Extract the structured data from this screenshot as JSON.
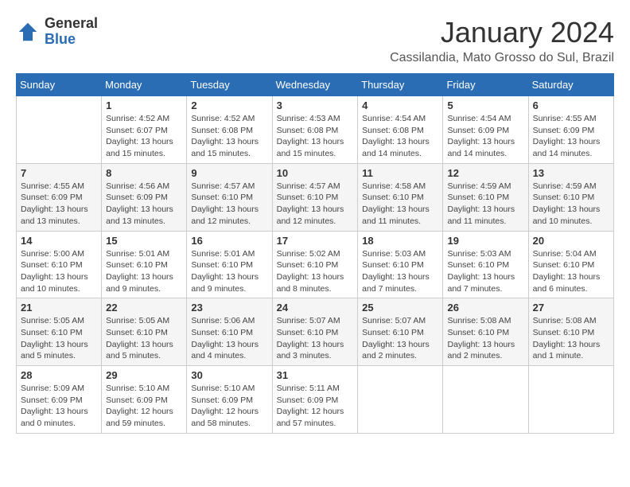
{
  "logo": {
    "general": "General",
    "blue": "Blue"
  },
  "title": "January 2024",
  "location": "Cassilandia, Mato Grosso do Sul, Brazil",
  "days_header": [
    "Sunday",
    "Monday",
    "Tuesday",
    "Wednesday",
    "Thursday",
    "Friday",
    "Saturday"
  ],
  "weeks": [
    [
      {
        "day": "",
        "info": ""
      },
      {
        "day": "1",
        "info": "Sunrise: 4:52 AM\nSunset: 6:07 PM\nDaylight: 13 hours\nand 15 minutes."
      },
      {
        "day": "2",
        "info": "Sunrise: 4:52 AM\nSunset: 6:08 PM\nDaylight: 13 hours\nand 15 minutes."
      },
      {
        "day": "3",
        "info": "Sunrise: 4:53 AM\nSunset: 6:08 PM\nDaylight: 13 hours\nand 15 minutes."
      },
      {
        "day": "4",
        "info": "Sunrise: 4:54 AM\nSunset: 6:08 PM\nDaylight: 13 hours\nand 14 minutes."
      },
      {
        "day": "5",
        "info": "Sunrise: 4:54 AM\nSunset: 6:09 PM\nDaylight: 13 hours\nand 14 minutes."
      },
      {
        "day": "6",
        "info": "Sunrise: 4:55 AM\nSunset: 6:09 PM\nDaylight: 13 hours\nand 14 minutes."
      }
    ],
    [
      {
        "day": "7",
        "info": "Sunrise: 4:55 AM\nSunset: 6:09 PM\nDaylight: 13 hours\nand 13 minutes."
      },
      {
        "day": "8",
        "info": "Sunrise: 4:56 AM\nSunset: 6:09 PM\nDaylight: 13 hours\nand 13 minutes."
      },
      {
        "day": "9",
        "info": "Sunrise: 4:57 AM\nSunset: 6:10 PM\nDaylight: 13 hours\nand 12 minutes."
      },
      {
        "day": "10",
        "info": "Sunrise: 4:57 AM\nSunset: 6:10 PM\nDaylight: 13 hours\nand 12 minutes."
      },
      {
        "day": "11",
        "info": "Sunrise: 4:58 AM\nSunset: 6:10 PM\nDaylight: 13 hours\nand 11 minutes."
      },
      {
        "day": "12",
        "info": "Sunrise: 4:59 AM\nSunset: 6:10 PM\nDaylight: 13 hours\nand 11 minutes."
      },
      {
        "day": "13",
        "info": "Sunrise: 4:59 AM\nSunset: 6:10 PM\nDaylight: 13 hours\nand 10 minutes."
      }
    ],
    [
      {
        "day": "14",
        "info": "Sunrise: 5:00 AM\nSunset: 6:10 PM\nDaylight: 13 hours\nand 10 minutes."
      },
      {
        "day": "15",
        "info": "Sunrise: 5:01 AM\nSunset: 6:10 PM\nDaylight: 13 hours\nand 9 minutes."
      },
      {
        "day": "16",
        "info": "Sunrise: 5:01 AM\nSunset: 6:10 PM\nDaylight: 13 hours\nand 9 minutes."
      },
      {
        "day": "17",
        "info": "Sunrise: 5:02 AM\nSunset: 6:10 PM\nDaylight: 13 hours\nand 8 minutes."
      },
      {
        "day": "18",
        "info": "Sunrise: 5:03 AM\nSunset: 6:10 PM\nDaylight: 13 hours\nand 7 minutes."
      },
      {
        "day": "19",
        "info": "Sunrise: 5:03 AM\nSunset: 6:10 PM\nDaylight: 13 hours\nand 7 minutes."
      },
      {
        "day": "20",
        "info": "Sunrise: 5:04 AM\nSunset: 6:10 PM\nDaylight: 13 hours\nand 6 minutes."
      }
    ],
    [
      {
        "day": "21",
        "info": "Sunrise: 5:05 AM\nSunset: 6:10 PM\nDaylight: 13 hours\nand 5 minutes."
      },
      {
        "day": "22",
        "info": "Sunrise: 5:05 AM\nSunset: 6:10 PM\nDaylight: 13 hours\nand 5 minutes."
      },
      {
        "day": "23",
        "info": "Sunrise: 5:06 AM\nSunset: 6:10 PM\nDaylight: 13 hours\nand 4 minutes."
      },
      {
        "day": "24",
        "info": "Sunrise: 5:07 AM\nSunset: 6:10 PM\nDaylight: 13 hours\nand 3 minutes."
      },
      {
        "day": "25",
        "info": "Sunrise: 5:07 AM\nSunset: 6:10 PM\nDaylight: 13 hours\nand 2 minutes."
      },
      {
        "day": "26",
        "info": "Sunrise: 5:08 AM\nSunset: 6:10 PM\nDaylight: 13 hours\nand 2 minutes."
      },
      {
        "day": "27",
        "info": "Sunrise: 5:08 AM\nSunset: 6:10 PM\nDaylight: 13 hours\nand 1 minute."
      }
    ],
    [
      {
        "day": "28",
        "info": "Sunrise: 5:09 AM\nSunset: 6:09 PM\nDaylight: 13 hours\nand 0 minutes."
      },
      {
        "day": "29",
        "info": "Sunrise: 5:10 AM\nSunset: 6:09 PM\nDaylight: 12 hours\nand 59 minutes."
      },
      {
        "day": "30",
        "info": "Sunrise: 5:10 AM\nSunset: 6:09 PM\nDaylight: 12 hours\nand 58 minutes."
      },
      {
        "day": "31",
        "info": "Sunrise: 5:11 AM\nSunset: 6:09 PM\nDaylight: 12 hours\nand 57 minutes."
      },
      {
        "day": "",
        "info": ""
      },
      {
        "day": "",
        "info": ""
      },
      {
        "day": "",
        "info": ""
      }
    ]
  ]
}
